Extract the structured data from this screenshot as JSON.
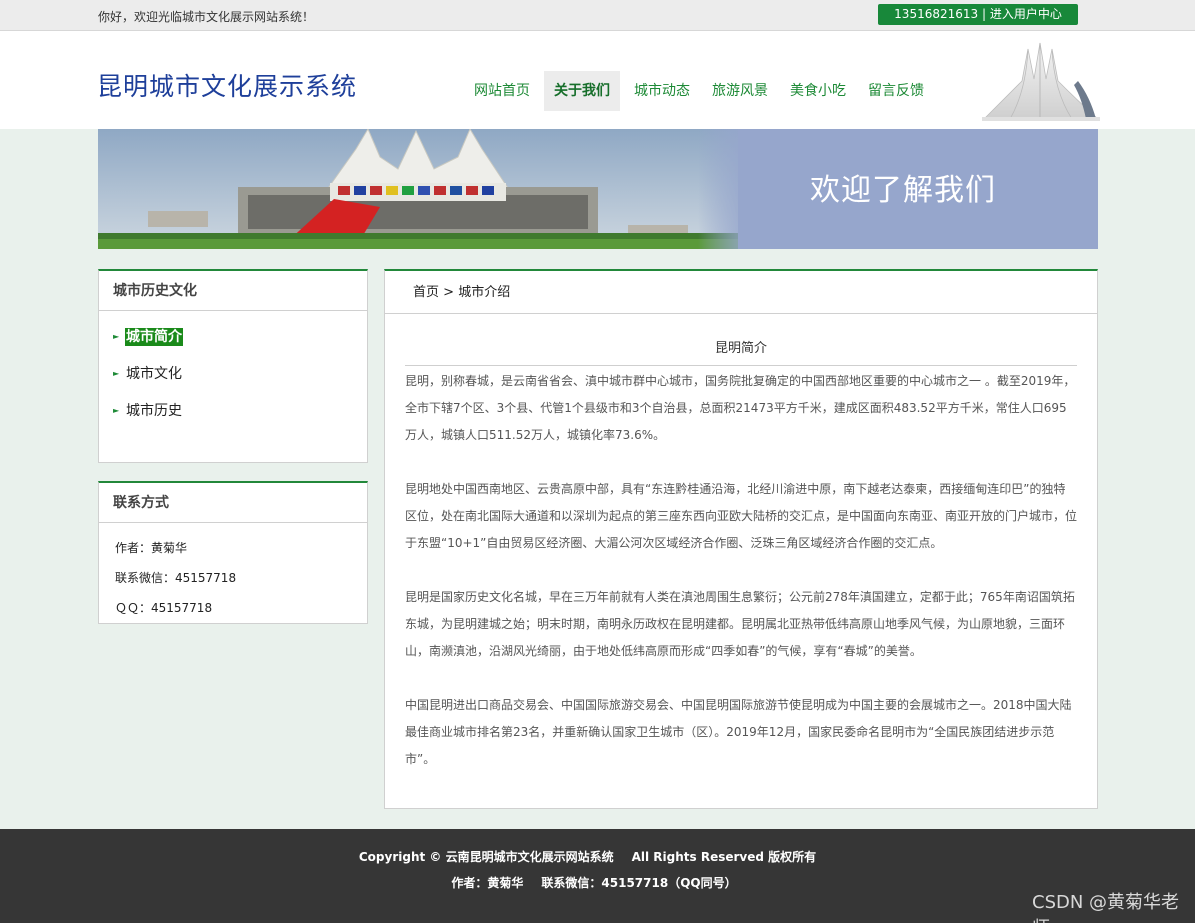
{
  "topbar": {
    "welcome": "你好，欢迎光临城市文化展示网站系统！",
    "user_center": "13516821613 | 进入用户中心"
  },
  "header": {
    "title": "昆明城市文化展示系统",
    "nav": [
      "网站首页",
      "关于我们",
      "城市动态",
      "旅游风景",
      "美食小吃",
      "留言反馈"
    ],
    "active_nav": "关于我们"
  },
  "banner": {
    "text": "欢迎了解我们"
  },
  "sidebar": {
    "history": {
      "title": "城市历史文化",
      "items": [
        "城市简介",
        "城市文化",
        "城市历史"
      ],
      "active": "城市简介"
    },
    "contact": {
      "title": "联系方式",
      "author": "作者：黄菊华",
      "wechat": "联系微信：45157718",
      "qq": "ＱＱ：45157718"
    }
  },
  "main": {
    "breadcrumb": {
      "home": "首页",
      "sep": ">",
      "current": "城市介绍"
    },
    "article_title": "昆明简介",
    "paragraphs": [
      "昆明，别称春城，是云南省省会、滇中城市群中心城市，国务院批复确定的中国西部地区重要的中心城市之一 。截至2019年，全市下辖7个区、3个县、代管1个县级市和3个自治县，总面积21473平方千米，建成区面积483.52平方千米，常住人口695万人，城镇人口511.52万人，城镇化率73.6%。",
      "昆明地处中国西南地区、云贵高原中部，具有“东连黔桂通沿海，北经川渝进中原，南下越老达泰柬，西接缅甸连印巴”的独特区位，处在南北国际大通道和以深圳为起点的第三座东西向亚欧大陆桥的交汇点，是中国面向东南亚、南亚开放的门户城市，位于东盟“10+1”自由贸易区经济圈、大湄公河次区域经济合作圈、泛珠三角区域经济合作圈的交汇点。",
      "昆明是国家历史文化名城，早在三万年前就有人类在滇池周围生息繁衍；公元前278年滇国建立，定都于此；765年南诏国筑拓东城，为昆明建城之始；明末时期，南明永历政权在昆明建都。昆明属北亚热带低纬高原山地季风气候，为山原地貌，三面环山，南濒滇池，沿湖风光绮丽，由于地处低纬高原而形成“四季如春”的气候，享有“春城”的美誉。",
      "中国昆明进出口商品交易会、中国国际旅游交易会、中国昆明国际旅游节使昆明成为中国主要的会展城市之一。2018中国大陆最佳商业城市排名第23名，并重新确认国家卫生城市（区）。2019年12月，国家民委命名昆明市为“全国民族团结进步示范市”。"
    ]
  },
  "footer": {
    "copyright": "Copyright © 云南昆明城市文化展示网站系统",
    "rights": "All Rights Reserved 版权所有",
    "author": "作者：黄菊华",
    "wechat": "联系微信：45157718（QQ同号）"
  },
  "watermark": "CSDN @黄菊华老师",
  "colors": {
    "accent_green": "#18883a",
    "title_blue": "#1e3f9a",
    "footer_bg": "#363636",
    "page_bg": "#e9f1ec"
  }
}
